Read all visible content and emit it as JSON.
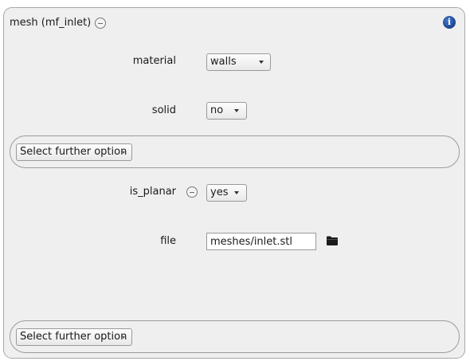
{
  "panel": {
    "title": "mesh (mf_inlet)",
    "collapse_icon": "minus-circle-icon",
    "info_icon": "info-icon",
    "info_glyph": "i"
  },
  "fields": {
    "material": {
      "label": "material",
      "value": "walls"
    },
    "solid": {
      "label": "solid",
      "value": "no"
    },
    "is_planar": {
      "label": "is_planar",
      "value": "yes",
      "remove_icon": "minus-circle-icon"
    },
    "file": {
      "label": "file",
      "value": "meshes/inlet.stl",
      "browse_icon": "folder-icon"
    }
  },
  "further_options": [
    {
      "label": "Select further option"
    },
    {
      "label": "Select further option"
    }
  ],
  "colors": {
    "panel_background": "#efefef",
    "panel_border": "#a8a8a8",
    "info_blue": "#1f4f9e"
  }
}
